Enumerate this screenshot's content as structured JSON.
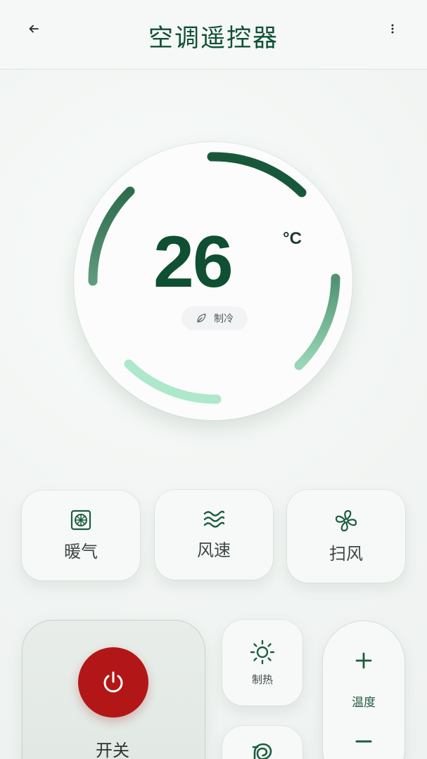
{
  "header": {
    "title": "空调遥控器",
    "back_icon": "arrow-left-icon",
    "more_icon": "more-vertical-icon"
  },
  "dial": {
    "temperature": "26",
    "unit": "°C",
    "mode_label": "制冷",
    "mode_icon": "leaf-icon"
  },
  "functions": [
    {
      "label": "暖气",
      "icon": "heater-icon"
    },
    {
      "label": "风速",
      "icon": "wind-icon"
    },
    {
      "label": "扫风",
      "icon": "fan-icon"
    }
  ],
  "power": {
    "label": "开关",
    "icon": "power-icon"
  },
  "heat_button": {
    "label": "制热",
    "icon": "sun-icon"
  },
  "extra_button": {
    "icon": "air-flow-icon"
  },
  "temp_rocker": {
    "label": "温度",
    "plus_icon": "plus-icon",
    "minus_icon": "minus-icon"
  },
  "colors": {
    "accent": "#0f5136",
    "power_red": "#b31616",
    "arc_light": "#a9e8c8"
  }
}
